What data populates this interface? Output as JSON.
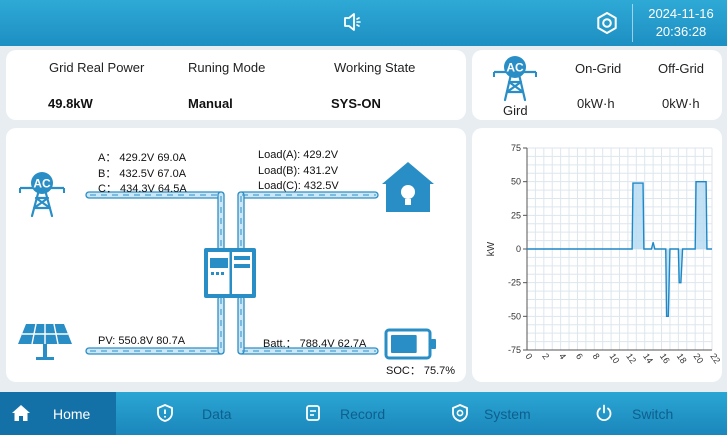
{
  "header": {
    "speaker_icon": "speaker-icon",
    "settings_icon": "gear-icon",
    "date": "2024-11-16",
    "time": "20:36:28"
  },
  "summary": {
    "grid_power_label": "Grid Real Power",
    "grid_power_value": "49.8kW",
    "mode_label": "Runing Mode",
    "mode_value": "Manual",
    "state_label": "Working State",
    "state_value": "SYS-ON"
  },
  "grid_energy": {
    "icon_text": "AC",
    "icon_label": "Gird",
    "on_grid_label": "On-Grid",
    "on_grid_value": "0kW·h",
    "off_grid_label": "Off-Grid",
    "off_grid_value": "0kW·h"
  },
  "flow": {
    "grid_icon_text": "AC",
    "phase_a": "A：  429.2V   69.0A",
    "phase_b": "B：  432.5V   67.0A",
    "phase_c": "C：  434.3V   64.5A",
    "load_a": "Load(A):  429.2V",
    "load_b": "Load(B):  431.2V",
    "load_c": "Load(C):  432.5V",
    "pv": "PV:   550.8V    80.7A",
    "batt": "Batt.：  788.4V    62.7A",
    "soc": "SOC：  75.7%",
    "soc_level": 0.757,
    "colors": {
      "accent": "#2a8ec6",
      "pipe": "#cfe7f5"
    }
  },
  "chart_data": {
    "type": "area",
    "ylabel": "kW",
    "ylim": [
      -75,
      75
    ],
    "xlim": [
      0,
      22
    ],
    "yticks": [
      "75",
      "50",
      "25",
      "0",
      "-25",
      "-50",
      "-75"
    ],
    "xticks": [
      "0",
      "2",
      "4",
      "6",
      "8",
      "10",
      "12",
      "14",
      "16",
      "18",
      "20",
      "22"
    ],
    "grid": true,
    "series": [
      {
        "x": [
          0,
          12.5,
          12.6,
          13.8,
          13.9,
          14.8,
          15.0,
          15.2,
          16.5,
          16.6,
          16.8,
          17.0,
          18.0,
          18.1,
          18.3,
          18.5,
          20.0,
          20.1,
          21.3,
          21.4,
          22
        ],
        "values": [
          0,
          0,
          49,
          49,
          0,
          0,
          5,
          0,
          0,
          -50,
          -50,
          0,
          0,
          -25,
          -25,
          0,
          0,
          50,
          50,
          0,
          0
        ]
      }
    ]
  },
  "nav": {
    "home": "Home",
    "data": "Data",
    "record": "Record",
    "system": "System",
    "switch": "Switch"
  }
}
